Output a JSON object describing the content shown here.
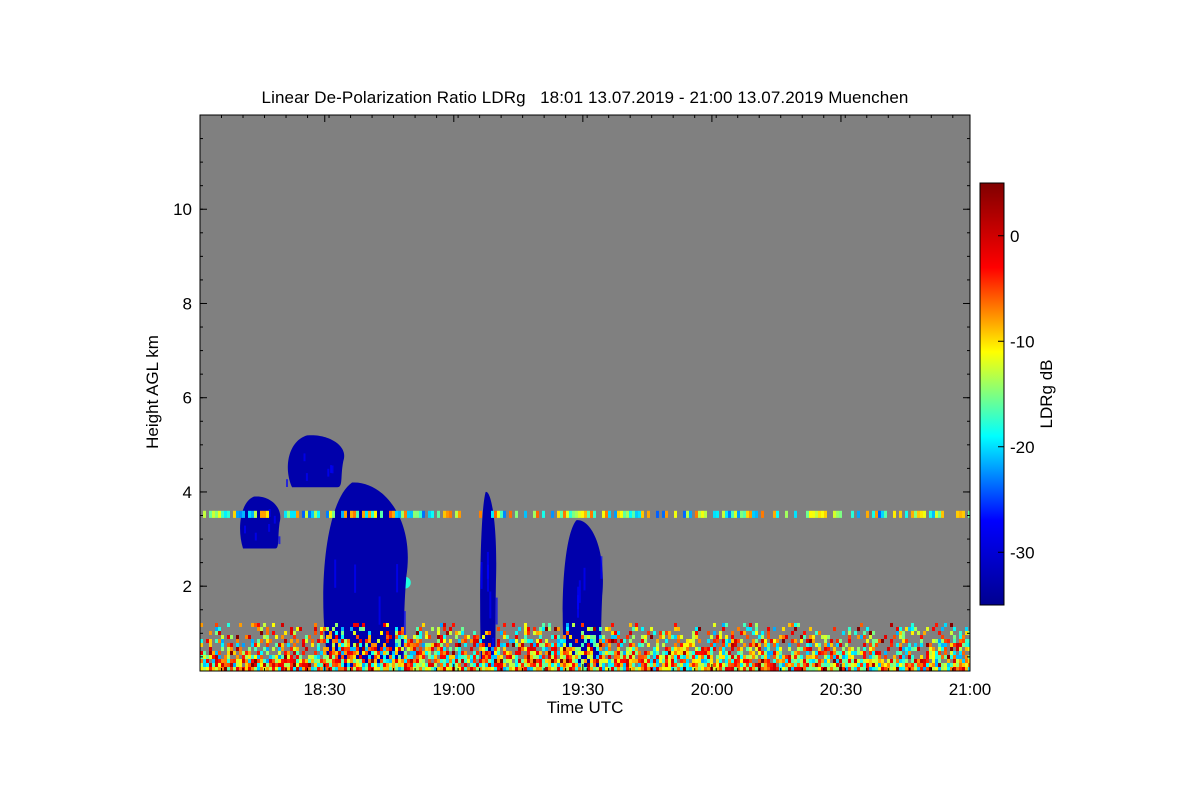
{
  "chart_data": {
    "type": "heatmap",
    "title": "Linear De-Polarization Ratio LDRg   18:01 13.07.2019 - 21:00 13.07.2019 Muenchen",
    "xlabel": "Time UTC",
    "ylabel": "Height AGL km",
    "x_start": "18:01",
    "x_end": "21:00",
    "xticks": [
      "18:30",
      "19:00",
      "19:30",
      "20:00",
      "20:30",
      "21:00"
    ],
    "xtick_values": [
      "18:30",
      "19:00",
      "19:30",
      "20:00",
      "20:30",
      "21:00"
    ],
    "ylim": [
      0.2,
      12
    ],
    "yticks": [
      2,
      4,
      6,
      8,
      10
    ],
    "background_color": "#808080",
    "colorbar": {
      "label": "LDRg dB",
      "range": [
        -35,
        5
      ],
      "ticks": [
        0,
        -10,
        -20,
        -30
      ],
      "colormap": [
        "#00008f",
        "#0000ff",
        "#00ffff",
        "#ffff00",
        "#ff0000",
        "#800000"
      ]
    },
    "features": [
      {
        "name": "cloud-4.7km",
        "t_start": "18:21",
        "t_end": "18:35",
        "h_min": 4.1,
        "h_max": 5.2,
        "ldr": -33
      },
      {
        "name": "cloud-3km",
        "t_start": "18:10",
        "t_end": "18:20",
        "h_min": 2.8,
        "h_max": 3.9,
        "ldr": -33
      },
      {
        "name": "melting-layer",
        "t_start": "18:32",
        "t_end": "18:50",
        "h_min": 1.95,
        "h_max": 2.2,
        "ldr": -18
      },
      {
        "name": "precip-column-1",
        "t_start": "18:29",
        "t_end": "18:50",
        "h_min": 0.2,
        "h_max": 4.2,
        "ldr": -33
      },
      {
        "name": "precip-column-2",
        "t_start": "19:06",
        "t_end": "19:10",
        "h_min": 0.2,
        "h_max": 4.0,
        "ldr": -33
      },
      {
        "name": "precip-column-3",
        "t_start": "19:25",
        "t_end": "19:35",
        "h_min": 0.2,
        "h_max": 3.4,
        "ldr": -33
      },
      {
        "name": "aerosol-layer-3.5km",
        "t_start": "18:01",
        "t_end": "21:00",
        "h_min": 3.45,
        "h_max": 3.6,
        "ldr": -15
      },
      {
        "name": "boundary-layer",
        "t_start": "18:01",
        "t_end": "21:00",
        "h_min": 0.2,
        "h_max": 1.2,
        "ldr": -10
      }
    ]
  }
}
